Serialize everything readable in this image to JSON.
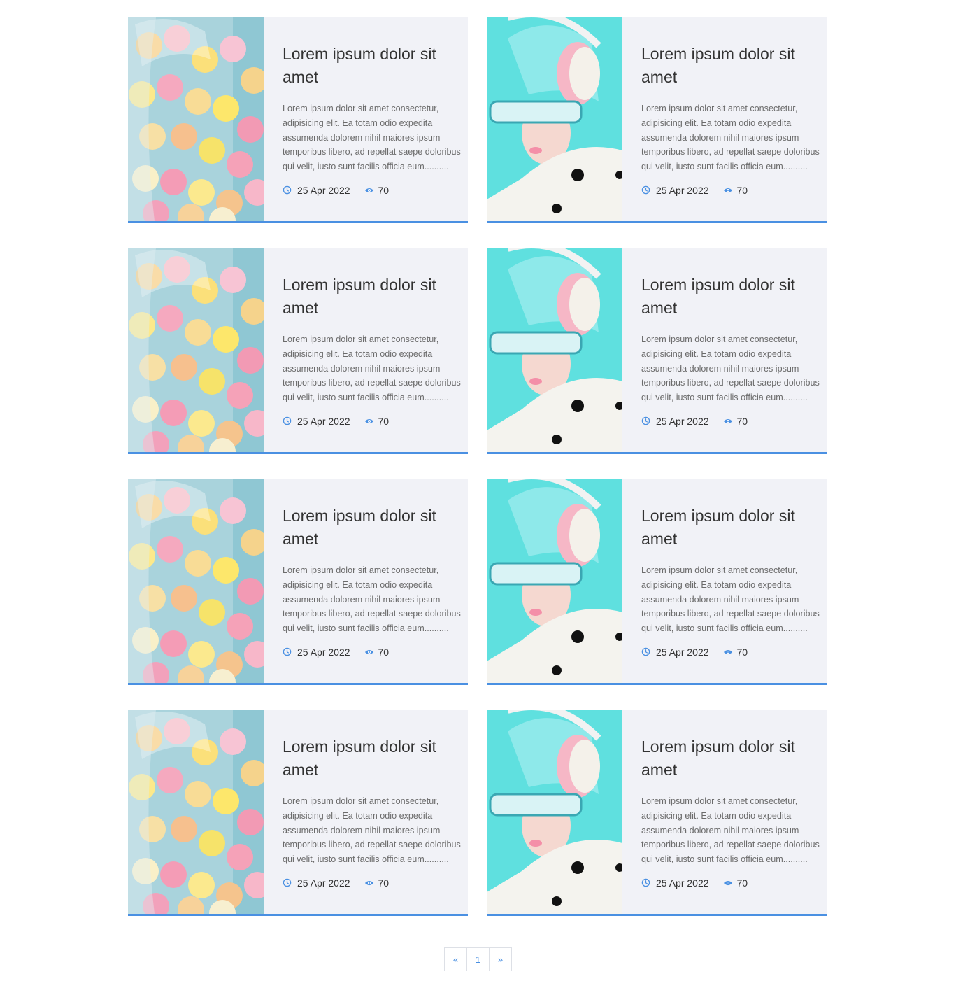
{
  "colors": {
    "accent": "#4a90e2",
    "card_bg": "#f1f2f7"
  },
  "posts": [
    {
      "image": "candy-jar-photo",
      "title": "Lorem ipsum dolor sit amet",
      "excerpt": "Lorem ipsum dolor sit amet consectetur, adipisicing elit. Ea totam odio expedita assumenda dolorem nihil maiores ipsum temporibus libero, ad repellat saepe doloribus qui velit, iusto sunt facilis officia eum..........",
      "date": "25 Apr 2022",
      "views": "70",
      "date_icon": "clock-icon",
      "views_icon": "eye-icon"
    },
    {
      "image": "headphones-woman-photo",
      "title": "Lorem ipsum dolor sit amet",
      "excerpt": "Lorem ipsum dolor sit amet consectetur, adipisicing elit. Ea totam odio expedita assumenda dolorem nihil maiores ipsum temporibus libero, ad repellat saepe doloribus qui velit, iusto sunt facilis officia eum..........",
      "date": "25 Apr 2022",
      "views": "70",
      "date_icon": "clock-icon",
      "views_icon": "eye-icon"
    },
    {
      "image": "candy-jar-photo",
      "title": "Lorem ipsum dolor sit amet",
      "excerpt": "Lorem ipsum dolor sit amet consectetur, adipisicing elit. Ea totam odio expedita assumenda dolorem nihil maiores ipsum temporibus libero, ad repellat saepe doloribus qui velit, iusto sunt facilis officia eum..........",
      "date": "25 Apr 2022",
      "views": "70",
      "date_icon": "clock-icon",
      "views_icon": "eye-icon"
    },
    {
      "image": "headphones-woman-photo",
      "title": "Lorem ipsum dolor sit amet",
      "excerpt": "Lorem ipsum dolor sit amet consectetur, adipisicing elit. Ea totam odio expedita assumenda dolorem nihil maiores ipsum temporibus libero, ad repellat saepe doloribus qui velit, iusto sunt facilis officia eum..........",
      "date": "25 Apr 2022",
      "views": "70",
      "date_icon": "clock-icon",
      "views_icon": "eye-icon"
    },
    {
      "image": "candy-jar-photo",
      "title": "Lorem ipsum dolor sit amet",
      "excerpt": "Lorem ipsum dolor sit amet consectetur, adipisicing elit. Ea totam odio expedita assumenda dolorem nihil maiores ipsum temporibus libero, ad repellat saepe doloribus qui velit, iusto sunt facilis officia eum..........",
      "date": "25 Apr 2022",
      "views": "70",
      "date_icon": "clock-icon",
      "views_icon": "eye-icon"
    },
    {
      "image": "headphones-woman-photo",
      "title": "Lorem ipsum dolor sit amet",
      "excerpt": "Lorem ipsum dolor sit amet consectetur, adipisicing elit. Ea totam odio expedita assumenda dolorem nihil maiores ipsum temporibus libero, ad repellat saepe doloribus qui velit, iusto sunt facilis officia eum..........",
      "date": "25 Apr 2022",
      "views": "70",
      "date_icon": "clock-icon",
      "views_icon": "eye-icon"
    },
    {
      "image": "candy-jar-photo",
      "title": "Lorem ipsum dolor sit amet",
      "excerpt": "Lorem ipsum dolor sit amet consectetur, adipisicing elit. Ea totam odio expedita assumenda dolorem nihil maiores ipsum temporibus libero, ad repellat saepe doloribus qui velit, iusto sunt facilis officia eum..........",
      "date": "25 Apr 2022",
      "views": "70",
      "date_icon": "clock-icon",
      "views_icon": "eye-icon"
    },
    {
      "image": "headphones-woman-photo",
      "title": "Lorem ipsum dolor sit amet",
      "excerpt": "Lorem ipsum dolor sit amet consectetur, adipisicing elit. Ea totam odio expedita assumenda dolorem nihil maiores ipsum temporibus libero, ad repellat saepe doloribus qui velit, iusto sunt facilis officia eum..........",
      "date": "25 Apr 2022",
      "views": "70",
      "date_icon": "clock-icon",
      "views_icon": "eye-icon"
    }
  ],
  "pagination": {
    "prev_label": "«",
    "page_label": "1",
    "next_label": "»"
  }
}
